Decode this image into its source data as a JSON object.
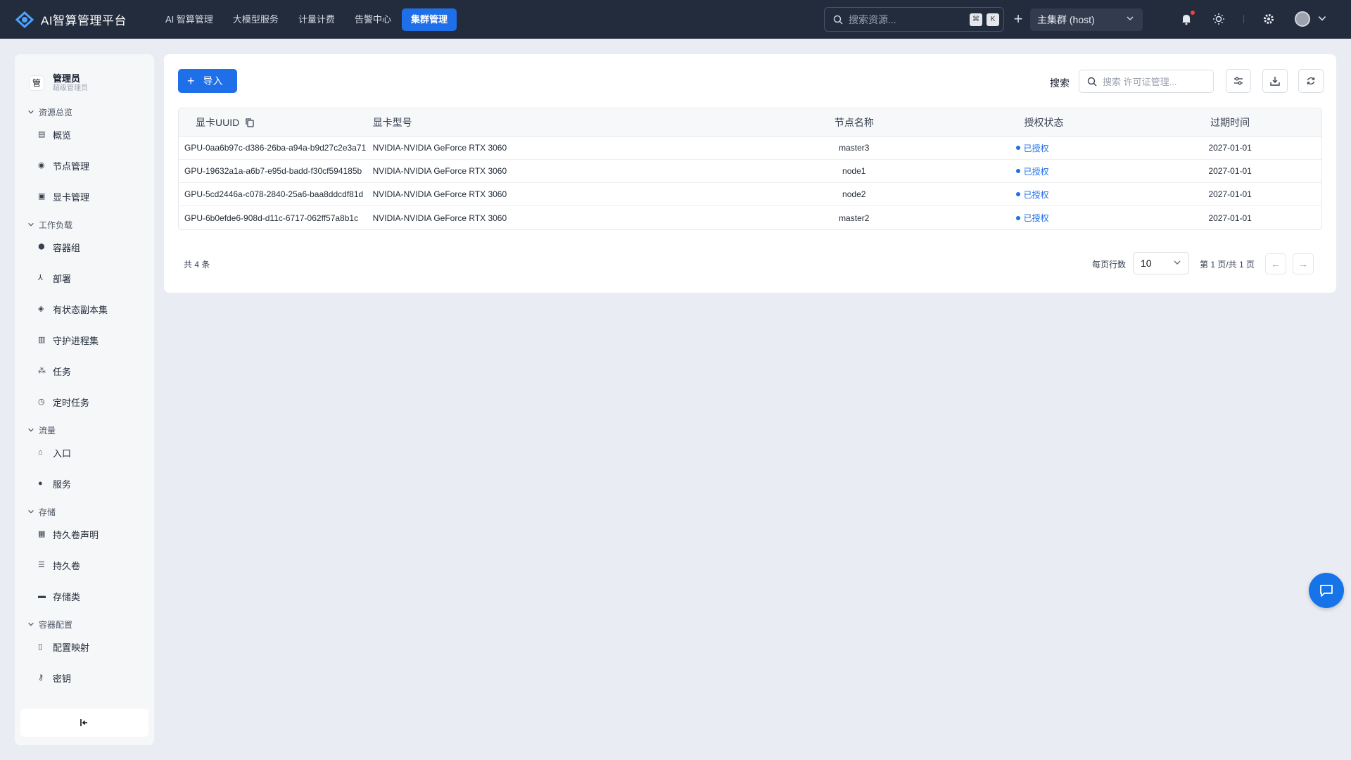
{
  "app": {
    "title": "AI智算管理平台"
  },
  "nav": {
    "items": [
      {
        "label": "AI 智算管理",
        "active": false
      },
      {
        "label": "大模型服务",
        "active": false
      },
      {
        "label": "计量计费",
        "active": false
      },
      {
        "label": "告警中心",
        "active": false
      },
      {
        "label": "集群管理",
        "active": true
      }
    ]
  },
  "topbar": {
    "search_placeholder": "搜索资源...",
    "kbd_cmd": "⌘",
    "kbd_k": "K",
    "cluster": "主集群 (host)"
  },
  "user": {
    "badge": "管",
    "name": "管理员",
    "role": "超级管理员"
  },
  "sidebar": {
    "groups": [
      {
        "title": "资源总览",
        "items": [
          {
            "label": "概览",
            "icon": "chart-icon"
          },
          {
            "label": "节点管理",
            "icon": "node-icon"
          },
          {
            "label": "显卡管理",
            "icon": "gpu-icon"
          }
        ]
      },
      {
        "title": "工作负载",
        "items": [
          {
            "label": "容器组",
            "icon": "cube-icon"
          },
          {
            "label": "部署",
            "icon": "deploy-icon"
          },
          {
            "label": "有状态副本集",
            "icon": "layers-icon"
          },
          {
            "label": "守护进程集",
            "icon": "daemon-icon"
          },
          {
            "label": "任务",
            "icon": "job-icon"
          },
          {
            "label": "定时任务",
            "icon": "clock-icon"
          }
        ]
      },
      {
        "title": "流量",
        "items": [
          {
            "label": "入口",
            "icon": "ingress-icon"
          },
          {
            "label": "服务",
            "icon": "service-icon"
          }
        ]
      },
      {
        "title": "存储",
        "items": [
          {
            "label": "持久卷声明",
            "icon": "pvc-icon"
          },
          {
            "label": "持久卷",
            "icon": "database-icon"
          },
          {
            "label": "存储类",
            "icon": "storage-class-icon"
          }
        ]
      },
      {
        "title": "容器配置",
        "items": [
          {
            "label": "配置映射",
            "icon": "configmap-icon"
          },
          {
            "label": "密钥",
            "icon": "key-icon"
          }
        ]
      }
    ]
  },
  "toolbar": {
    "import_label": "导入",
    "search_label": "搜索",
    "search_placeholder": "搜索 许可证管理..."
  },
  "table": {
    "columns": [
      "显卡UUID",
      "显卡型号",
      "节点名称",
      "授权状态",
      "过期时间"
    ],
    "rows": [
      {
        "uuid": "GPU-0aa6b97c-d386-26ba-a94a-b9d27c2e3a71",
        "model": "NVIDIA-NVIDIA GeForce RTX 3060",
        "node": "master3",
        "status": "已授权",
        "expire": "2027-01-01"
      },
      {
        "uuid": "GPU-19632a1a-a6b7-e95d-badd-f30cf594185b",
        "model": "NVIDIA-NVIDIA GeForce RTX 3060",
        "node": "node1",
        "status": "已授权",
        "expire": "2027-01-01"
      },
      {
        "uuid": "GPU-5cd2446a-c078-2840-25a6-baa8ddcdf81d",
        "model": "NVIDIA-NVIDIA GeForce RTX 3060",
        "node": "node2",
        "status": "已授权",
        "expire": "2027-01-01"
      },
      {
        "uuid": "GPU-6b0efde6-908d-d11c-6717-062ff57a8b1c",
        "model": "NVIDIA-NVIDIA GeForce RTX 3060",
        "node": "master2",
        "status": "已授权",
        "expire": "2027-01-01"
      }
    ]
  },
  "pagination": {
    "total": "共 4 条",
    "page_size_label": "每页行数",
    "page_size": "10",
    "page_info": "第 1 页/共 1 页",
    "prev": "←",
    "next": "→"
  },
  "colors": {
    "accent": "#1e6fe8",
    "topbar": "#232c3d",
    "background": "#e9edf3"
  }
}
